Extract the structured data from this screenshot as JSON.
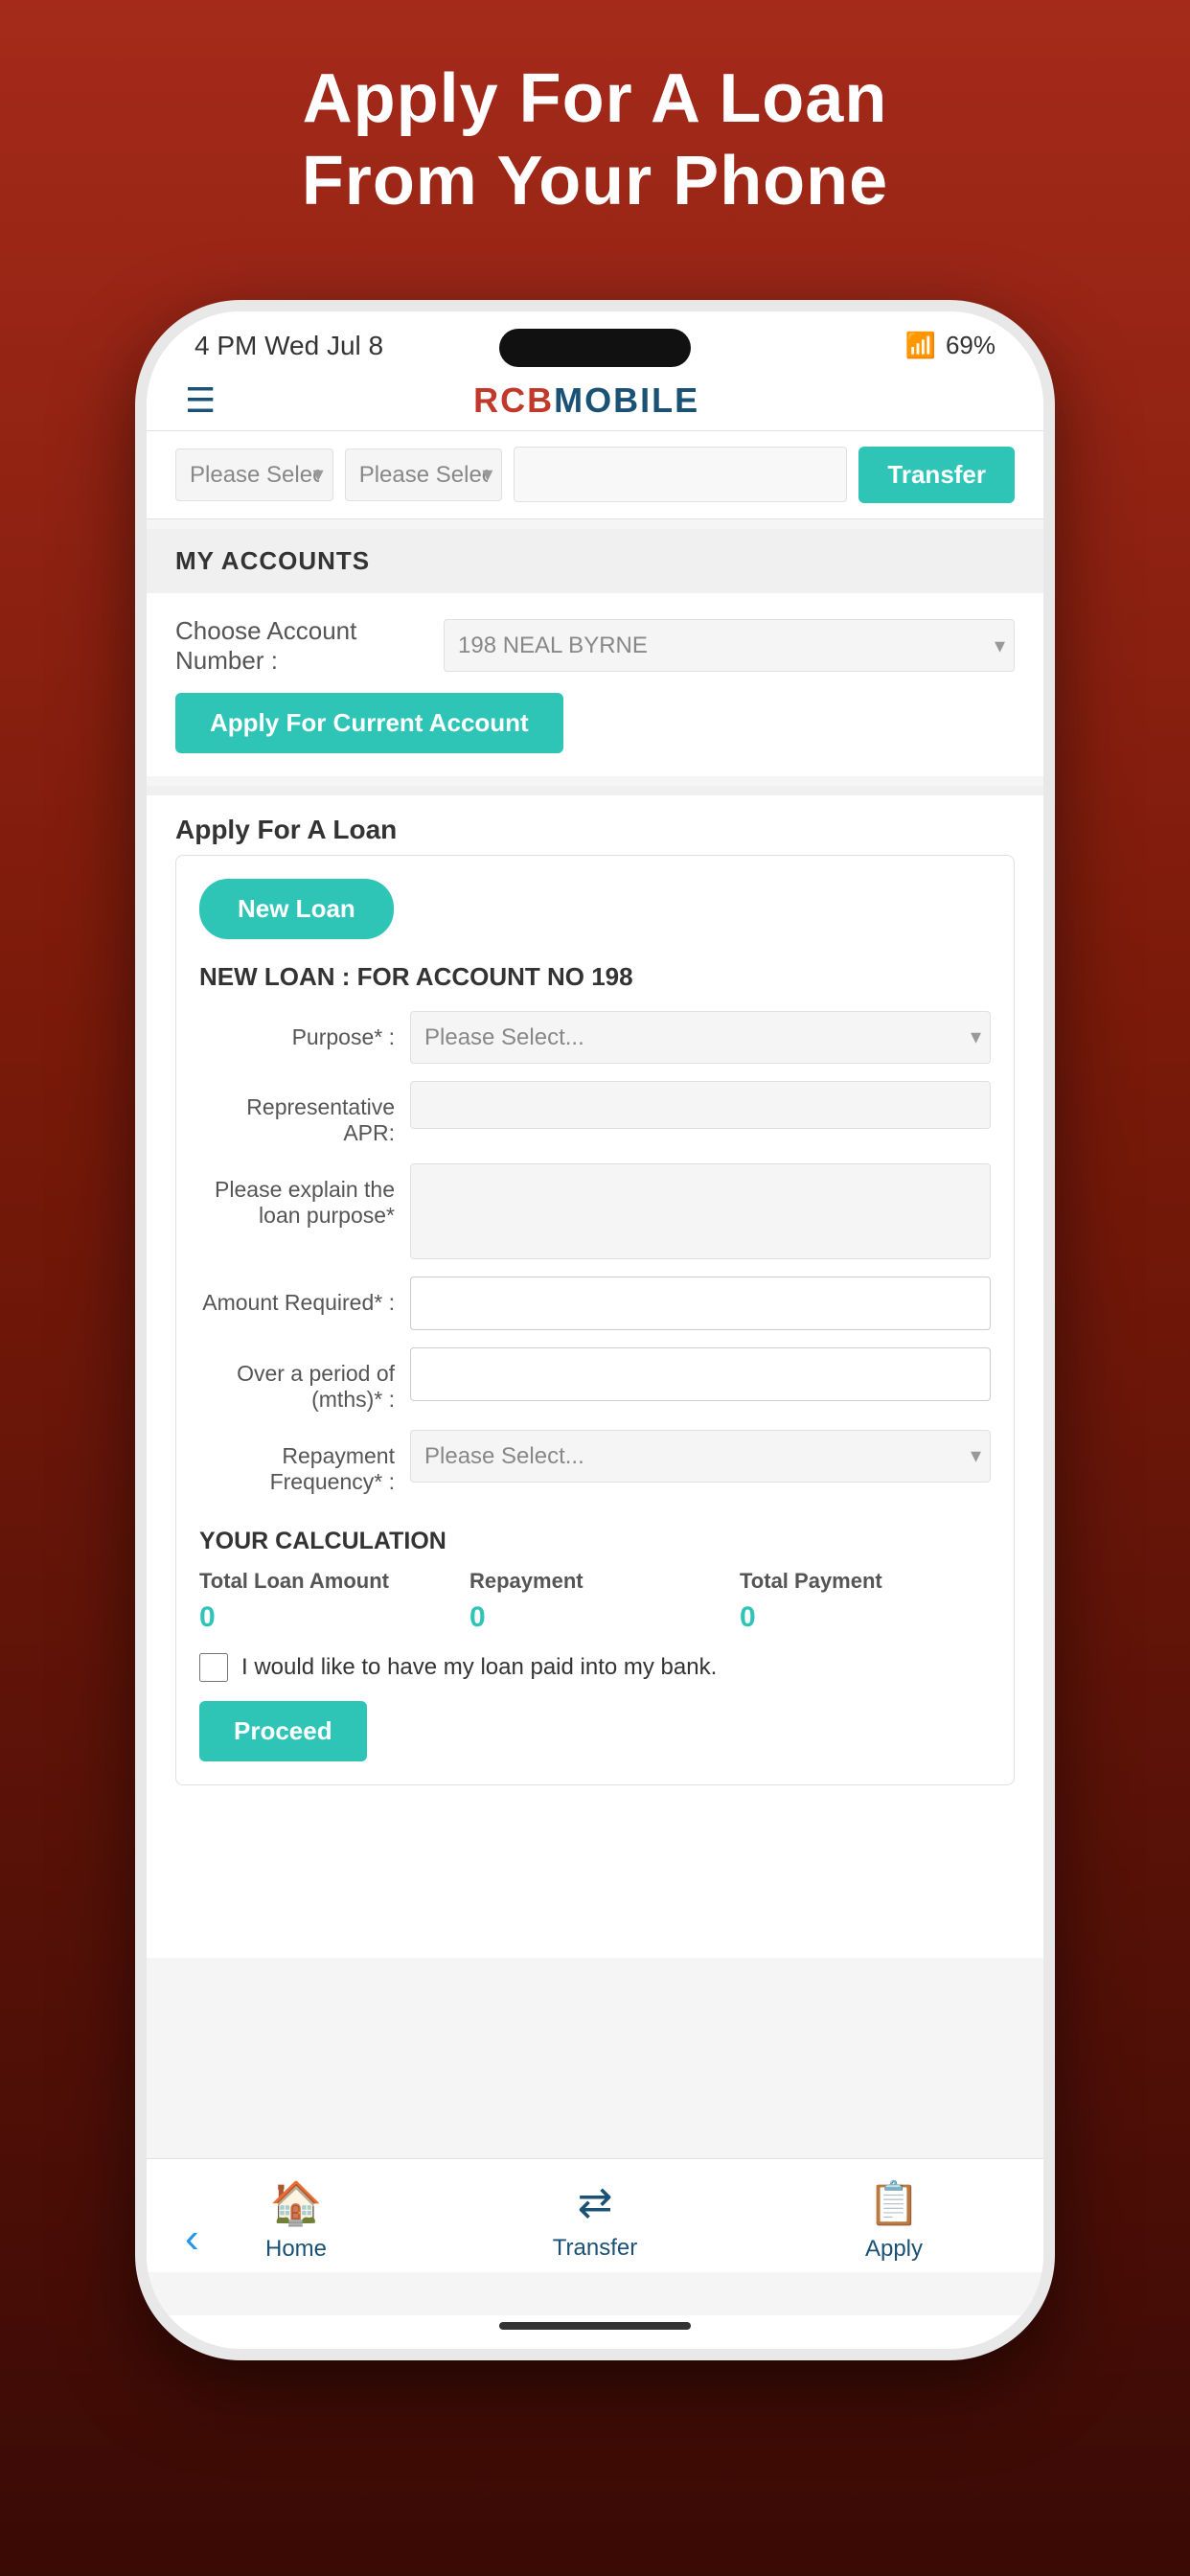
{
  "page": {
    "header_line1": "Apply For A Loan",
    "header_line2": "From Your Phone"
  },
  "status_bar": {
    "time": "4 PM  Wed Jul 8",
    "battery": "69%",
    "wifi": "WiFi"
  },
  "app_bar": {
    "logo_text": "RCB MOBILE",
    "menu_icon": "☰"
  },
  "transfer_bar": {
    "select1_placeholder": "Please Select...",
    "select2_placeholder": "Please Select...",
    "input_placeholder": "",
    "transfer_btn_label": "Transfer"
  },
  "my_accounts": {
    "section_label": "MY ACCOUNTS",
    "choose_account_label": "Choose Account Number :",
    "account_value": "198 NEAL BYRNE",
    "apply_current_account_btn": "Apply For Current Account"
  },
  "loan_section": {
    "title": "Apply For A Loan",
    "new_loan_btn": "New Loan",
    "loan_account_title": "NEW LOAN : FOR ACCOUNT NO 198",
    "purpose_label": "Purpose* :",
    "purpose_placeholder": "Please Select...",
    "apr_label": "Representative APR:",
    "apr_value": "",
    "explain_label": "Please explain the loan purpose*",
    "amount_label": "Amount Required* :",
    "period_label": "Over a period of (mths)* :",
    "frequency_label": "Repayment Frequency* :",
    "frequency_placeholder": "Please Select...",
    "calc_title": "YOUR CALCULATION",
    "total_loan_label": "Total Loan Amount",
    "repayment_label": "Repayment",
    "total_payment_label": "Total Payment",
    "total_loan_value": "0",
    "repayment_value": "0",
    "total_payment_value": "0",
    "checkbox_label": "I would like to have my loan paid into my bank.",
    "proceed_btn": "Proceed"
  },
  "bottom_nav": {
    "home_label": "Home",
    "transfer_label": "Transfer",
    "apply_label": "Apply",
    "home_icon": "⌂",
    "transfer_icon": "⇄",
    "apply_icon": "📋"
  }
}
